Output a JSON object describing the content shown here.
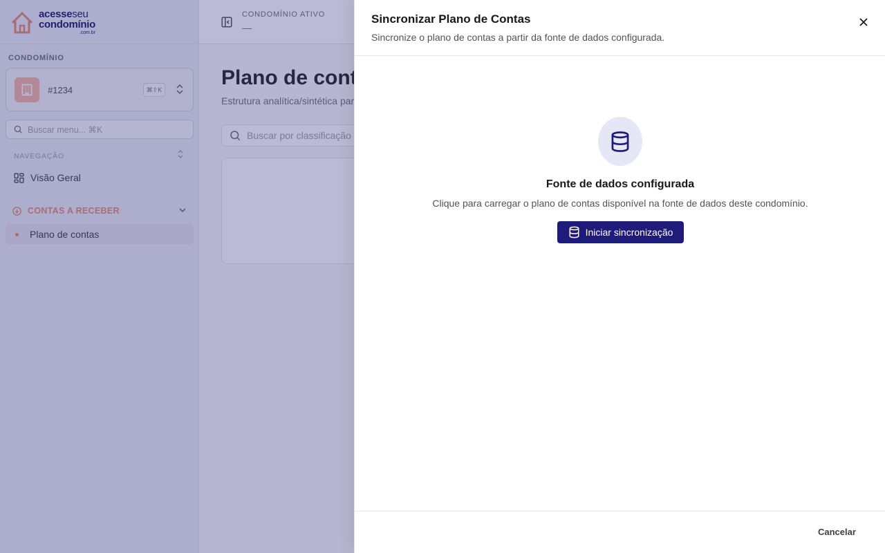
{
  "brand": {
    "line1_a": "acesse",
    "line1_b": "seu",
    "line2": "condomínio",
    "line3": ".com.br"
  },
  "sidebar": {
    "condo_section_label": "CONDOMÍNIO",
    "condo_id": "#1234",
    "condo_shortcut": "⌘⇧K",
    "search_placeholder": "Buscar menu... ⌘K",
    "nav_label": "NAVEGAÇÃO",
    "items": [
      {
        "label": "Visão Geral"
      }
    ],
    "group": {
      "label": "CONTAS A RECEBER",
      "items": [
        {
          "label": "Plano de contas"
        }
      ]
    }
  },
  "topbar": {
    "active_label": "CONDOMÍNIO ATIVO",
    "active_value": "—"
  },
  "main": {
    "title": "Plano de contas",
    "subtitle": "Estrutura analítica/sintética para",
    "search_placeholder": "Buscar por classificação"
  },
  "sheet": {
    "title": "Sincronizar Plano de Contas",
    "description": "Sincronize o plano de contas a partir da fonte de dados configurada.",
    "empty_title": "Fonte de dados configurada",
    "empty_desc": "Clique para carregar o plano de contas disponível na fonte de dados deste condomínio.",
    "sync_label": "Iniciar sincronização",
    "cancel_label": "Cancelar"
  },
  "colors": {
    "primary": "#1e1b7b",
    "accent": "#e88c72",
    "overlay": "#28287852"
  },
  "icons": [
    "logo-house-icon",
    "building-icon",
    "chevrons-up-down-icon",
    "search-icon",
    "sort-icon",
    "grid-icon",
    "circle-arrow-icon",
    "chevron-down-icon",
    "sidebar-toggle-icon",
    "close-icon",
    "database-icon"
  ]
}
